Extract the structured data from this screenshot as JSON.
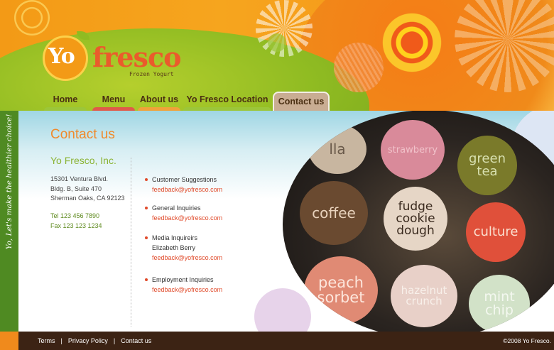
{
  "logo": {
    "yo": "Yo",
    "fresco": "fresco",
    "subtitle": "Frozen Yogurt"
  },
  "nav": [
    {
      "label": "Home",
      "bar_color": "#9cc63a"
    },
    {
      "label": "Menu",
      "bar_color": "#e05a4a"
    },
    {
      "label": "About us",
      "bar_color": "#f0a23a"
    },
    {
      "label": "Yo Fresco Location",
      "bar_color": "#9cc63a"
    },
    {
      "label": "Contact us",
      "active": true
    }
  ],
  "sidebar": {
    "slogan": "Yo, Let's make the healthier choice!"
  },
  "main": {
    "title": "Contact us",
    "company": "Yo Fresco, Inc.",
    "address": [
      "15301 Ventura Blvd.",
      "Bldg. B, Suite 470",
      "Sherman Oaks, CA 92123"
    ],
    "phones": [
      "Tel 123 456 7890",
      "Fax 123 123 1234"
    ],
    "inquiries": [
      {
        "lines": [
          "Customer Suggestions"
        ],
        "email": "feedback@yofresco.com"
      },
      {
        "lines": [
          "General Inquiries"
        ],
        "email": "feedback@yofresco.com"
      },
      {
        "lines": [
          "Media Inquireirs",
          "Elizabeth Berry"
        ],
        "email": "feedback@yofresco.com"
      },
      {
        "lines": [
          "Employment Inquiries"
        ],
        "email": "feedback@yofresco.com"
      }
    ]
  },
  "photo_tags": [
    {
      "label": "lla",
      "bg": "#c8b6a0",
      "color": "#6a5a4a"
    },
    {
      "label": "strawberry",
      "bg": "#d98a9a",
      "color": "#f1c2ca"
    },
    {
      "label": "green tea",
      "bg": "#7a7a2a",
      "color": "#d8e0b0"
    },
    {
      "label": "coffee",
      "bg": "#6a4a30",
      "color": "#e8d2bc"
    },
    {
      "label": "fudge cookie dough",
      "bg": "#e6d6c6",
      "color": "#3a2a1e"
    },
    {
      "label": "culture",
      "bg": "#e0503a",
      "color": "#fbe0d0"
    },
    {
      "label": "peach sorbet",
      "bg": "#e08a74",
      "color": "#fde6dc"
    },
    {
      "label": "hazelnut crunch",
      "bg": "#e8d0c8",
      "color": "#f8f0ea"
    },
    {
      "label": "mint chip",
      "bg": "#d2e2c8",
      "color": "#f4f8f0"
    }
  ],
  "footer": {
    "links": [
      "Terms",
      "Privacy Policy",
      "Contact us"
    ],
    "copyright": "©2008 Yo Fresco."
  },
  "colors": {
    "accent_orange": "#f08a2b",
    "accent_green": "#8bb334",
    "link_red": "#e04a2a",
    "footer_bg": "#3c2314"
  }
}
